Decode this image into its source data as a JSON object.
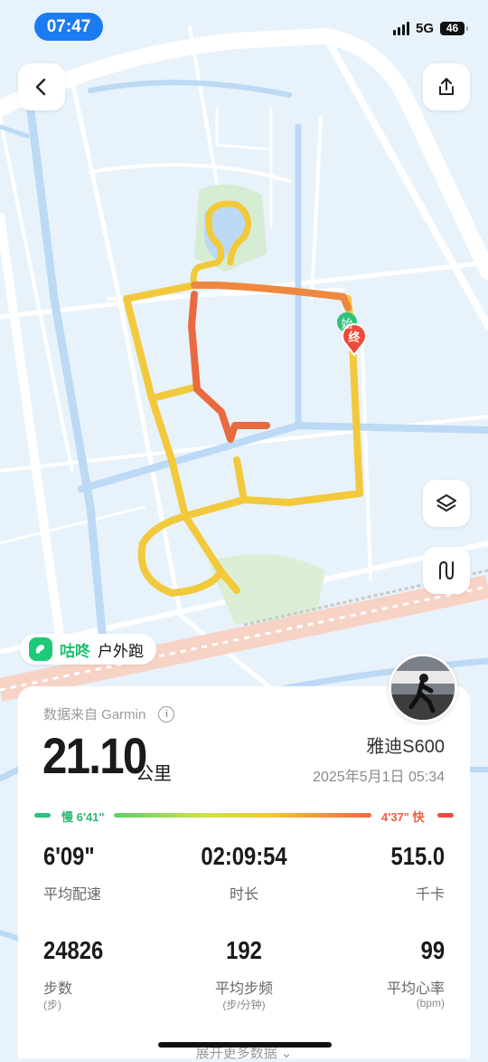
{
  "status": {
    "time": "07:47",
    "network": "5G",
    "battery": "46"
  },
  "map": {
    "start_marker": "始",
    "end_marker": "终",
    "back_icon": "chevron-left-icon",
    "share_icon": "share-icon",
    "layers_icon": "layers-icon",
    "route_icon": "route-icon"
  },
  "brand": {
    "name": "咕咚",
    "label": "户外跑"
  },
  "summary": {
    "source": "数据来自 Garmin",
    "distance": "21.10",
    "distance_unit": "公里",
    "device": "雅迪S600",
    "datetime": "2025年5月1日 05:34",
    "pace_slow": "慢 6'41\"",
    "pace_fast": "4'37\" 快"
  },
  "stats": [
    {
      "value": "6'09\"",
      "label": "平均配速",
      "unit": ""
    },
    {
      "value": "02:09:54",
      "label": "时长",
      "unit": ""
    },
    {
      "value": "515.0",
      "label": "千卡",
      "unit": ""
    },
    {
      "value": "24826",
      "label": "步数",
      "unit": "(步)"
    },
    {
      "value": "192",
      "label": "平均步频",
      "unit": "(步/分钟)"
    },
    {
      "value": "99",
      "label": "平均心率",
      "unit": "(bpm)"
    }
  ],
  "more_label": "展开更多数据",
  "colors": {
    "accent": "#1a7cf0",
    "brand": "#1ec978",
    "route_yellow": "#f2c93a",
    "route_orange": "#ee7a40"
  }
}
